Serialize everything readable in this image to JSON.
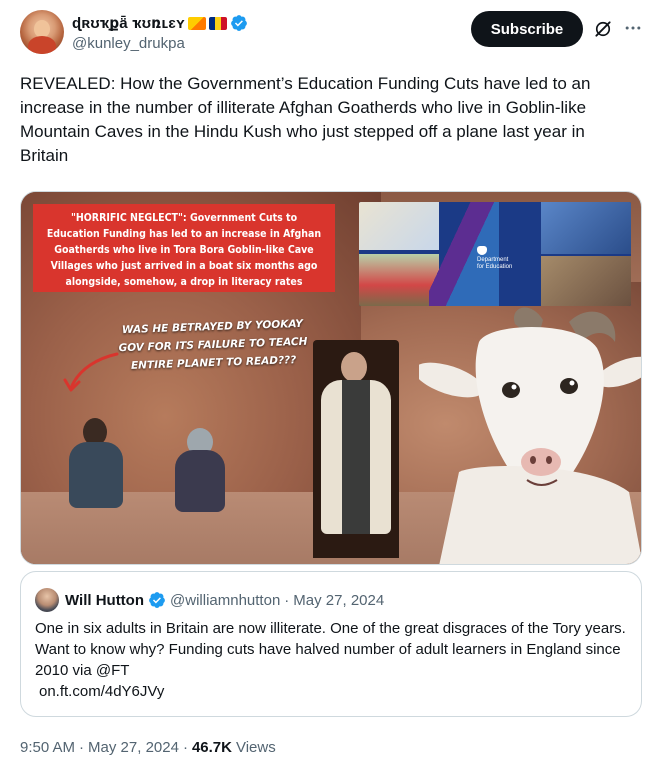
{
  "author": {
    "display_name": "ɖʀʊҡքǟ ҡʊռʟɛʏ",
    "handle": "@kunley_drukpa",
    "flags": [
      "bhutan-flag",
      "romania-flag"
    ],
    "verified": true
  },
  "actions": {
    "subscribe_label": "Subscribe",
    "grok_icon": "grok-icon",
    "more_icon": "more-icon"
  },
  "tweet": {
    "text": "REVEALED: How the Government’s Education Funding Cuts have led to an increase in the number of illiterate Afghan Goatherds who live in Goblin-like Mountain Caves in the Hindu Kush who just stepped off a plane last year in Britain"
  },
  "media": {
    "headline": "\"HORRIFIC NEGLECT\": Government Cuts to Education Funding has led to an increase in Afghan Goatherds who live in Tora Bora Goblin-like Cave Villages who just arrived in a boat six months ago alongside, somehow, a drop in literacy rates",
    "caption": "WAS HE BETRAYED BY YOOKAY GOV FOR ITS FAILURE TO TEACH ENTIRE PLANET TO READ???",
    "dfe_logo_line1": "Department",
    "dfe_logo_line2": "for Education"
  },
  "quoted_tweet": {
    "name": "Will Hutton",
    "handle": "@williamnhutton",
    "separator": "·",
    "date": "May 27, 2024",
    "text": "One in six adults in Britain are now illiterate. One of the great disgraces of the Tory years. Want to know why? Funding cuts have halved number of adult learners in England since 2010 via @FT",
    "link": "on.ft.com/4dY6JVy"
  },
  "meta": {
    "time": "9:50 AM",
    "separator": "·",
    "date": "May 27, 2024",
    "views_count": "46.7K",
    "views_label": "Views"
  },
  "colors": {
    "verified_blue": "#1d9bf0",
    "text_primary": "#0f1419",
    "text_secondary": "#536471",
    "border": "#cfd9de"
  }
}
